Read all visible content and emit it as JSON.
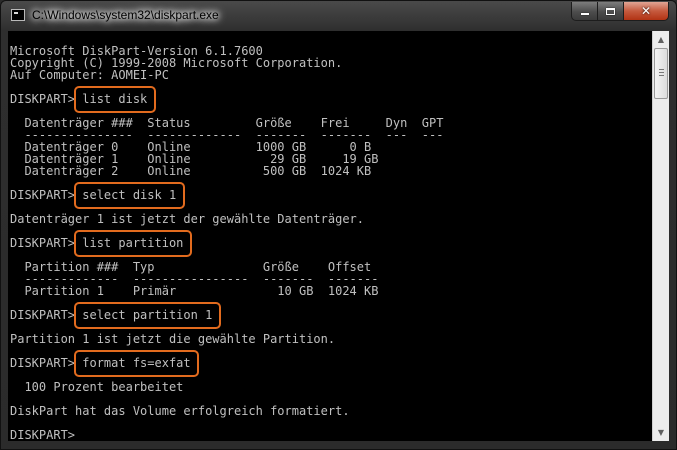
{
  "window": {
    "title": "C:\\Windows\\system32\\diskpart.exe",
    "icon": "console-icon",
    "buttons": {
      "minimize": "minimize-icon",
      "maximize": "maximize-icon",
      "close": "close-icon",
      "close_glyph": "✕"
    }
  },
  "console": {
    "lines": [
      "Microsoft DiskPart-Version 6.1.7600",
      "Copyright (C) 1999-2008 Microsoft Corporation.",
      "Auf Computer: AOMEI-PC",
      "",
      "DISKPART> list disk",
      "",
      "  Datenträger ###  Status         Größe    Frei     Dyn  GPT",
      "  ---------------  -------------  -------  -------  ---  ---",
      "  Datenträger 0    Online         1000 GB      0 B",
      "  Datenträger 1    Online           29 GB     19 GB",
      "  Datenträger 2    Online          500 GB  1024 KB",
      "",
      "DISKPART> select disk 1",
      "",
      "Datenträger 1 ist jetzt der gewählte Datenträger.",
      "",
      "DISKPART> list partition",
      "",
      "  Partition ###  Typ               Größe    Offset",
      "  -------------  ----------------  -------  -------",
      "  Partition 1    Primär              10 GB  1024 KB",
      "",
      "DISKPART> select partition 1",
      "",
      "Partition 1 ist jetzt die gewählte Partition.",
      "",
      "DISKPART> format fs=exfat",
      "",
      "  100 Prozent bearbeitet",
      "",
      "DiskPart hat das Volume erfolgreich formatiert.",
      "",
      "DISKPART> "
    ],
    "highlighted_commands": [
      "list disk",
      "select disk 1",
      "list partition",
      "select partition 1",
      "format fs=exfat"
    ],
    "highlight_color": "#e26b1e",
    "text_color": "#c0c0c0",
    "background_color": "#000000"
  },
  "scrollbar": {
    "up_arrow": "▲",
    "down_arrow": "▼"
  }
}
